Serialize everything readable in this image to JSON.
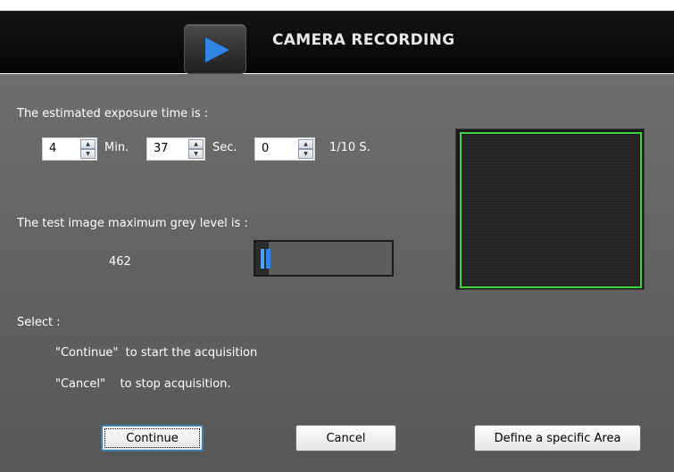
{
  "window": {
    "title": "CAMERA RECORDING",
    "play_icon": "play-icon",
    "accent_color": "#2f86e8"
  },
  "exposure": {
    "label": "The estimated exposure time is :",
    "minutes": {
      "value": "4",
      "unit": "Min."
    },
    "seconds": {
      "value": "37",
      "unit": "Sec."
    },
    "tenths": {
      "value": "0",
      "unit": "1/10 S."
    }
  },
  "grey_level": {
    "label": "The test image maximum grey level is :",
    "value": "462",
    "fraction": 0.1
  },
  "instructions": {
    "select_label": "Select :",
    "continue_text": "\"Continue\"  to start the acquisition",
    "cancel_text": "\"Cancel\"    to stop acquisition."
  },
  "buttons": {
    "continue": "Continue",
    "cancel": "Cancel",
    "define_area": "Define a specific Area"
  },
  "preview": {
    "roi_color": "#3fd23f"
  }
}
